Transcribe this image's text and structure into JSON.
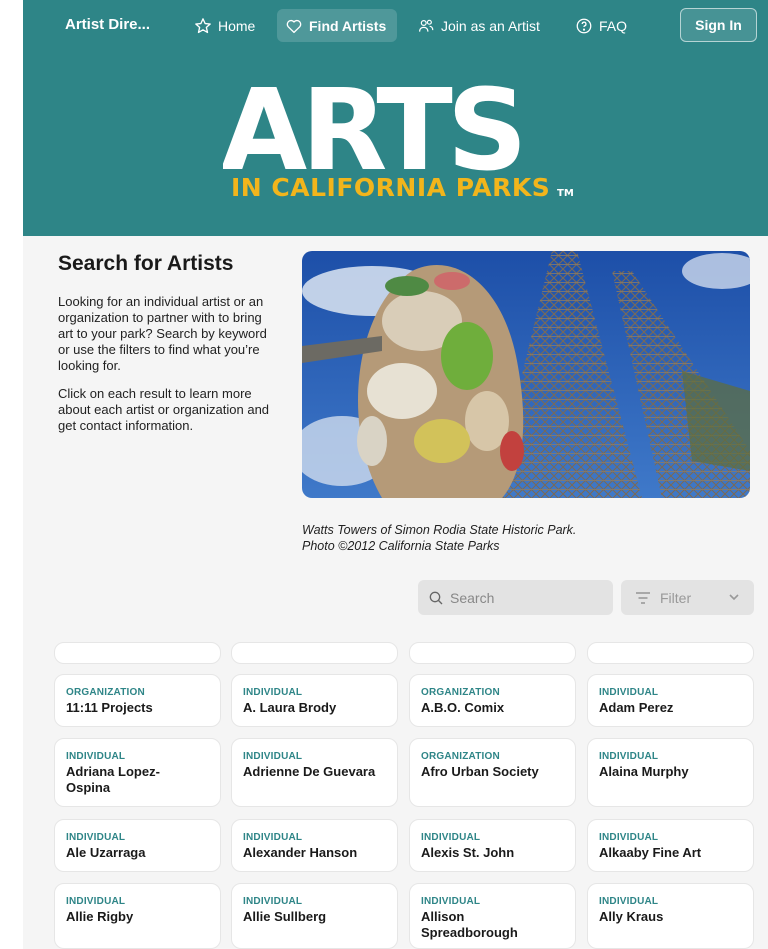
{
  "nav": {
    "brand": "Artist Dire...",
    "items": [
      {
        "label": "Home",
        "icon": "star-icon"
      },
      {
        "label": "Find Artists",
        "icon": "heart-icon"
      },
      {
        "label": "Join as an Artist",
        "icon": "users-icon"
      },
      {
        "label": "FAQ",
        "icon": "help-circle-icon"
      }
    ],
    "signin": "Sign In"
  },
  "logo": {
    "main": "ARTS",
    "sub": "IN CALIFORNIA PARKS",
    "tm": "TM"
  },
  "intro": {
    "title": "Search for Artists",
    "p1": "Looking for an individual artist or an organization to partner with to bring art to your park? Search by keyword or use the filters to find what you’re looking for.",
    "p2": "Click on each result to learn more about each artist or organization and get contact information."
  },
  "photo_caption": {
    "line1": "Watts Towers of Simon Rodia State Historic Park.",
    "line2": "Photo ©2012 California State Parks"
  },
  "search": {
    "placeholder": "Search"
  },
  "filter": {
    "label": "Filter"
  },
  "results": [
    {
      "type": "ORGANIZATION",
      "name": "11:11 Projects"
    },
    {
      "type": "INDIVIDUAL",
      "name": "A. Laura Brody"
    },
    {
      "type": "ORGANIZATION",
      "name": "A.B.O. Comix"
    },
    {
      "type": "INDIVIDUAL",
      "name": "Adam Perez"
    },
    {
      "type": "INDIVIDUAL",
      "name": "Adriana Lopez-Ospina"
    },
    {
      "type": "INDIVIDUAL",
      "name": "Adrienne De Guevara"
    },
    {
      "type": "ORGANIZATION",
      "name": "Afro Urban Society"
    },
    {
      "type": "INDIVIDUAL",
      "name": "Alaina Murphy"
    },
    {
      "type": "INDIVIDUAL",
      "name": "Ale Uzarraga"
    },
    {
      "type": "INDIVIDUAL",
      "name": "Alexander Hanson"
    },
    {
      "type": "INDIVIDUAL",
      "name": "Alexis St. John"
    },
    {
      "type": "INDIVIDUAL",
      "name": "Alkaaby Fine Art"
    },
    {
      "type": "INDIVIDUAL",
      "name": "Allie Rigby"
    },
    {
      "type": "INDIVIDUAL",
      "name": "Allie Sullberg"
    },
    {
      "type": "INDIVIDUAL",
      "name": "Allison Spreadborough"
    },
    {
      "type": "INDIVIDUAL",
      "name": "Ally Kraus"
    }
  ],
  "colors": {
    "brand_teal": "#2e8587",
    "logo_gold": "#f2b51c",
    "accent_text": "#2e8587"
  }
}
